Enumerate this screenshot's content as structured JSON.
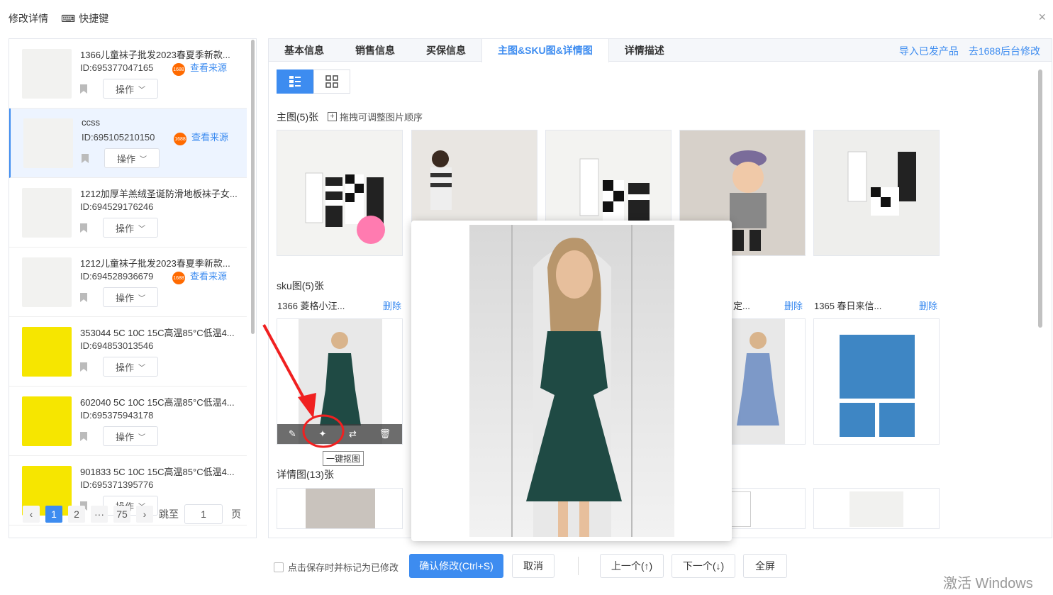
{
  "header": {
    "title": "修改详情",
    "shortcut": "快捷键",
    "close": "×"
  },
  "products": [
    {
      "title": "1366儿童袜子批发2023春夏季新款...",
      "id": "ID:695377047165",
      "badge": "1688",
      "src": "查看来源",
      "op": "操作",
      "thumb": "socks"
    },
    {
      "title": "ccss",
      "id": "ID:695105210150",
      "badge": "1688",
      "src": "查看来源",
      "op": "操作",
      "thumb": "socks"
    },
    {
      "title": "1212加厚羊羔绒圣诞防滑地板袜子女...",
      "id": "ID:694529176246",
      "op": "操作",
      "thumb": "socks"
    },
    {
      "title": "1212儿童袜子批发2023春夏季新款...",
      "id": "ID:694528936679",
      "badge": "1688",
      "src": "查看来源",
      "op": "操作",
      "thumb": "socks"
    },
    {
      "title": "353044 5C 10C 15C高温85°C低温4...",
      "id": "ID:694853013546",
      "op": "操作",
      "thumb": "yellow"
    },
    {
      "title": "602040 5C 10C 15C高温85°C低温4...",
      "id": "ID:695375943178",
      "op": "操作",
      "thumb": "yellow"
    },
    {
      "title": "901833 5C 10C 15C高温85°C低温4...",
      "id": "ID:695371395776",
      "op": "操作",
      "thumb": "yellow"
    }
  ],
  "pager": {
    "pages": [
      "1",
      "2",
      "···",
      "75"
    ],
    "jump_label": "跳至",
    "jump_value": "1",
    "page_suffix": "页"
  },
  "tabs": [
    "基本信息",
    "销售信息",
    "买保信息",
    "主图&SKU图&详情图",
    "详情描述"
  ],
  "top_links": [
    "导入已发产品",
    "去1688后台修改"
  ],
  "main_section": {
    "label": "主图(5)张",
    "hint": "拖拽可调整图片顺序"
  },
  "sku_section": {
    "label": "sku图(5)张",
    "items": [
      {
        "name": "1366 菱格小汪...",
        "del": "删除"
      },
      {
        "name": "定...",
        "del": "删除"
      },
      {
        "name": "1365 春日来信...",
        "del": "删除"
      }
    ]
  },
  "detail_section": {
    "label": "详情图(13)张"
  },
  "tooltip": "一键抠图",
  "footer": {
    "mark_label": "点击保存时并标记为已修改",
    "confirm": "确认修改(Ctrl+S)",
    "cancel": "取消",
    "prev": "上一个(↑)",
    "next": "下一个(↓)",
    "fullscreen": "全屏"
  },
  "watermark": "激活 Windows",
  "colors": {
    "accent": "#3d8cf0",
    "badge": "#ff6a00"
  }
}
